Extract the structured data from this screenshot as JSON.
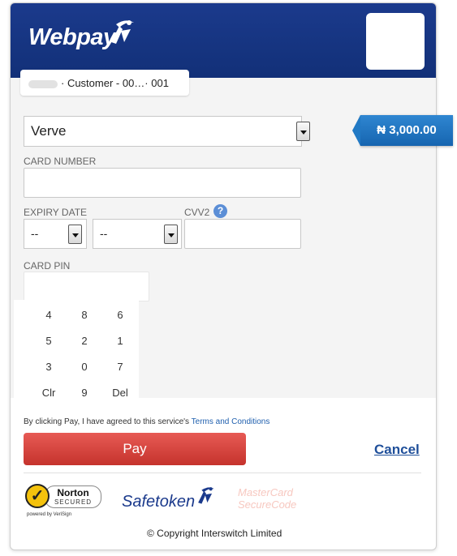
{
  "header": {
    "logo_text": "Webpay",
    "logo_icon": "runner-swoosh-icon",
    "merchant_logo": "redacted-merchant-logo"
  },
  "customer": {
    "text": "· Customer - 00…· 001"
  },
  "amount": "₦ 3,000.00",
  "form": {
    "card_type": "Verve",
    "card_number_label": "CARD NUMBER",
    "expiry_label": "EXPIRY DATE",
    "expiry_month": "--",
    "expiry_year": "--",
    "cvv_label": "CVV2",
    "cvv_help_icon": "?",
    "pin_label": "CARD PIN"
  },
  "keypad": {
    "keys": [
      "4",
      "8",
      "6",
      "5",
      "2",
      "1",
      "3",
      "0",
      "7",
      "Clr",
      "9",
      "Del"
    ]
  },
  "footer": {
    "terms_text": "By clicking Pay, I have agreed to this service's ",
    "terms_link": "Terms and Conditions",
    "pay_label": "Pay",
    "cancel_label": "Cancel",
    "norton_check": "✓",
    "norton_name": "Norton",
    "norton_secured": "SECURED",
    "norton_powered": "powered by VeriSign",
    "safetoken": "Safetoken",
    "mastercard_line1": "MasterCard",
    "mastercard_line2": "SecureCode",
    "copyright": "© Copyright Interswitch Limited"
  },
  "colors": {
    "header_blue": "#1b3a8c",
    "pay_red": "#d9443f",
    "amount_blue": "#1f77c7",
    "link_blue": "#1f4f9a"
  }
}
